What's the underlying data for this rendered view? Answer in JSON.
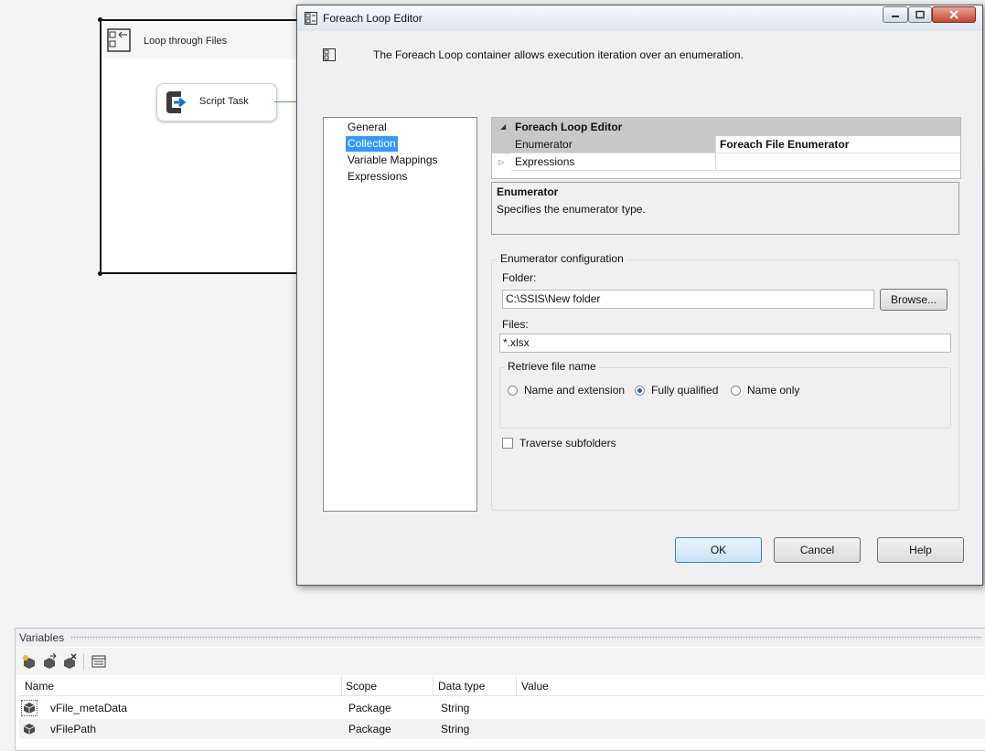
{
  "canvas": {
    "container_title": "Loop through Files",
    "task_label": "Script Task"
  },
  "dialog": {
    "title": "Foreach Loop Editor",
    "description": "The Foreach Loop container allows execution iteration over an enumeration.",
    "nav": {
      "items": [
        {
          "label": "General",
          "selected": false
        },
        {
          "label": "Collection",
          "selected": true
        },
        {
          "label": "Variable Mappings",
          "selected": false
        },
        {
          "label": "Expressions",
          "selected": false
        }
      ]
    },
    "property_grid": {
      "category": "Foreach Loop Editor",
      "rows": [
        {
          "name": "Enumerator",
          "value": "Foreach File Enumerator"
        },
        {
          "name": "Expressions",
          "value": ""
        }
      ]
    },
    "help": {
      "title": "Enumerator",
      "text": "Specifies the enumerator type."
    },
    "enum_config": {
      "legend": "Enumerator configuration",
      "folder_label": "Folder:",
      "folder_value": "C:\\SSIS\\New folder",
      "browse_label": "Browse...",
      "files_label": "Files:",
      "files_value": "*.xlsx",
      "retrieve_legend": "Retrieve file name",
      "options": [
        {
          "label": "Name and extension",
          "selected": false
        },
        {
          "label": "Fully qualified",
          "selected": true
        },
        {
          "label": "Name only",
          "selected": false
        }
      ],
      "traverse_label": "Traverse subfolders",
      "traverse_checked": false
    },
    "buttons": {
      "ok": "OK",
      "cancel": "Cancel",
      "help": "Help"
    }
  },
  "variables": {
    "title": "Variables",
    "toolbar": [
      "add-variable-icon",
      "move-variable-icon",
      "delete-variable-icon",
      "grid-options-icon"
    ],
    "columns": [
      "Name",
      "Scope",
      "Data type",
      "Value"
    ],
    "rows": [
      {
        "name": "vFile_metaData",
        "scope": "Package",
        "type": "String",
        "value": ""
      },
      {
        "name": "vFilePath",
        "scope": "Package",
        "type": "String",
        "value": ""
      }
    ]
  }
}
